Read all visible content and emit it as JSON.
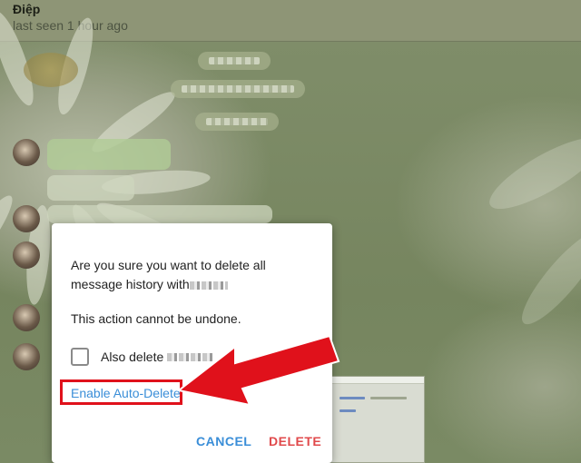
{
  "chat_header": {
    "name": "Điệp",
    "status": "last seen 1 hour ago"
  },
  "dialog": {
    "message": "Are you sure you want to delete all message history with",
    "warning": "This action cannot be undone.",
    "checkbox_label": "Also delete",
    "checkbox_checked": false,
    "enable_auto_delete": "Enable Auto-Delete",
    "cancel_label": "CANCEL",
    "delete_label": "DELETE"
  },
  "colors": {
    "link_blue": "#3a8ed8",
    "delete_red": "#e0494b",
    "annotation_red": "#e0111b"
  },
  "annotation": {
    "arrow_icon": "red-arrow-pointing-left",
    "highlight": "red-box-around-enable-auto-delete"
  }
}
